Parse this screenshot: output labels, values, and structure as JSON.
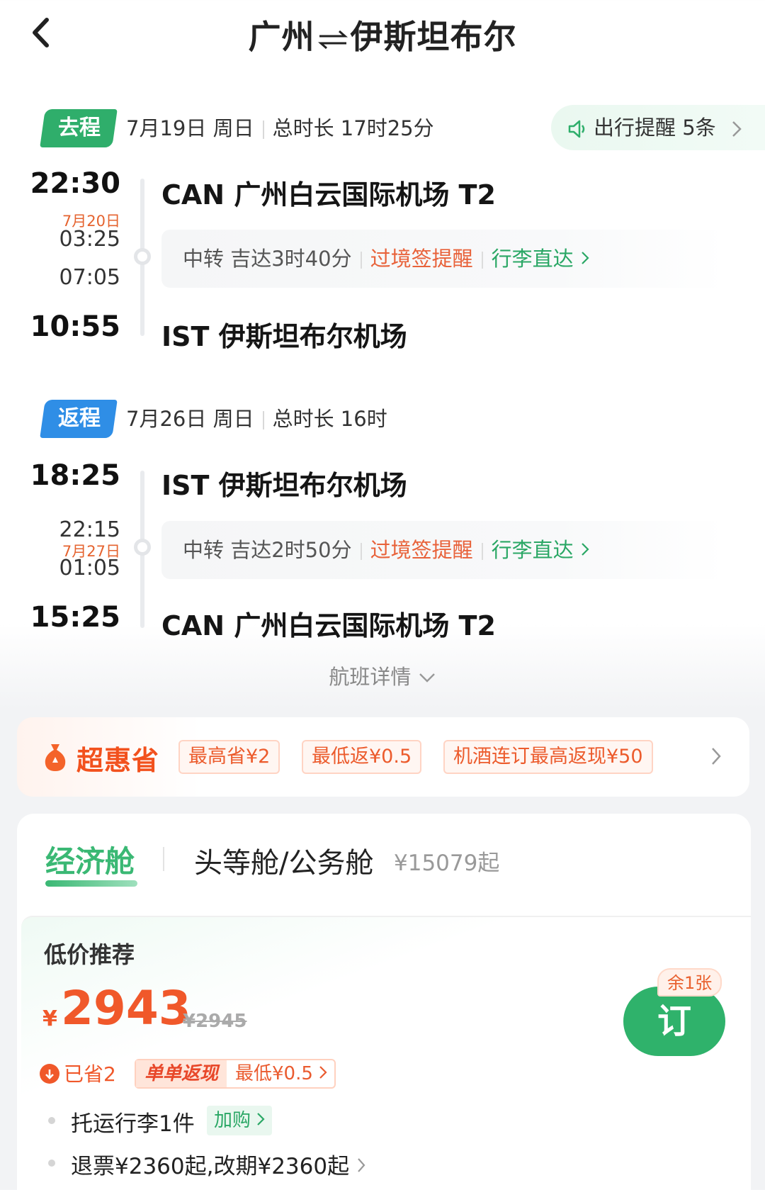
{
  "header": {
    "from": "广州",
    "to": "伊斯坦布尔",
    "back_icon": "chevron-left-icon"
  },
  "outbound": {
    "tag": "去程",
    "date": "7月19日 周日",
    "duration": "总时长 17时25分",
    "reminder": "出行提醒 5条",
    "depart_time": "22:30",
    "depart_airport": "CAN 广州白云国际机场 T2",
    "transfer_arrive_date": "7月20日",
    "transfer_arrive": "03:25",
    "transfer_depart": "07:05",
    "transfer_text": "中转 吉达3时40分",
    "transit_visa": "过境签提醒",
    "luggage_through": "行李直达",
    "arrive_time": "10:55",
    "arrive_airport": "IST 伊斯坦布尔机场"
  },
  "return": {
    "tag": "返程",
    "date": "7月26日 周日",
    "duration": "总时长 16时",
    "depart_time": "18:25",
    "depart_airport": "IST 伊斯坦布尔机场",
    "transfer_arrive": "22:15",
    "transfer_depart_date": "7月27日",
    "transfer_depart": "01:05",
    "transfer_text": "中转 吉达2时50分",
    "transit_visa": "过境签提醒",
    "luggage_through": "行李直达",
    "arrive_time": "15:25",
    "arrive_airport": "CAN 广州白云国际机场 T2"
  },
  "flight_details": "航班详情",
  "promo": {
    "title": "超惠省",
    "chips": [
      "最高省¥2",
      "最低返¥0.5",
      "机酒连订最高返现¥50"
    ]
  },
  "cabins": {
    "economy": "经济舱",
    "business": "头等舱/公务舱",
    "business_price": "¥15079起"
  },
  "offer": {
    "label": "低价推荐",
    "currency": "¥",
    "price": "2943",
    "original_price": "¥2945",
    "book": "订",
    "remaining": "余1张",
    "saved": "已省2",
    "cashback_label": "单单返现",
    "cashback_value": "最低¥0.5",
    "baggage": "托运行李1件",
    "add_purchase": "加购",
    "refund": "退票¥2360起,改期¥2360起"
  },
  "colors": {
    "green": "#2fae6b",
    "blue": "#2f8ee6",
    "orange": "#f0582a"
  }
}
